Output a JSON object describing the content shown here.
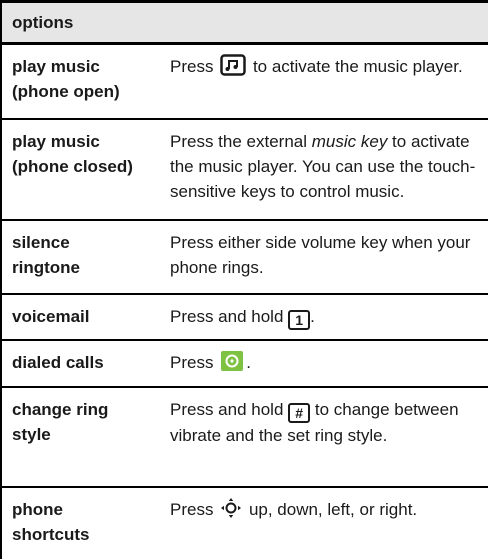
{
  "header": {
    "title": "options"
  },
  "rows": [
    {
      "label": [
        "play music",
        "(phone open)"
      ],
      "pre": "Press",
      "icon": "music-player-key-icon",
      "post": "to activate the music player."
    },
    {
      "label": [
        "play music",
        "(phone closed)"
      ],
      "text_a": "Press the external ",
      "italic": "music key",
      "text_b": " to activate the music player. You can use the touch-sensitive keys to control music."
    },
    {
      "label": [
        "silence",
        "ringtone"
      ],
      "text": "Press either side volume key when your phone rings."
    },
    {
      "label": [
        "voicemail"
      ],
      "pre": "Press and hold",
      "key": "1",
      "post": "."
    },
    {
      "label": [
        "dialed calls"
      ],
      "pre": "Press",
      "icon": "send-key-icon",
      "post": "."
    },
    {
      "label": [
        "change ring",
        "style"
      ],
      "pre": "Press and hold",
      "key": "#",
      "post": "to change between vibrate and the set ring style."
    },
    {
      "label": [
        "phone",
        "shortcuts"
      ],
      "pre": "Press",
      "icon": "nav-key-icon",
      "post": "up, down, left, or right."
    }
  ],
  "colors": {
    "send_key": "#7dc241",
    "header_bg": "#e6e6e6"
  }
}
